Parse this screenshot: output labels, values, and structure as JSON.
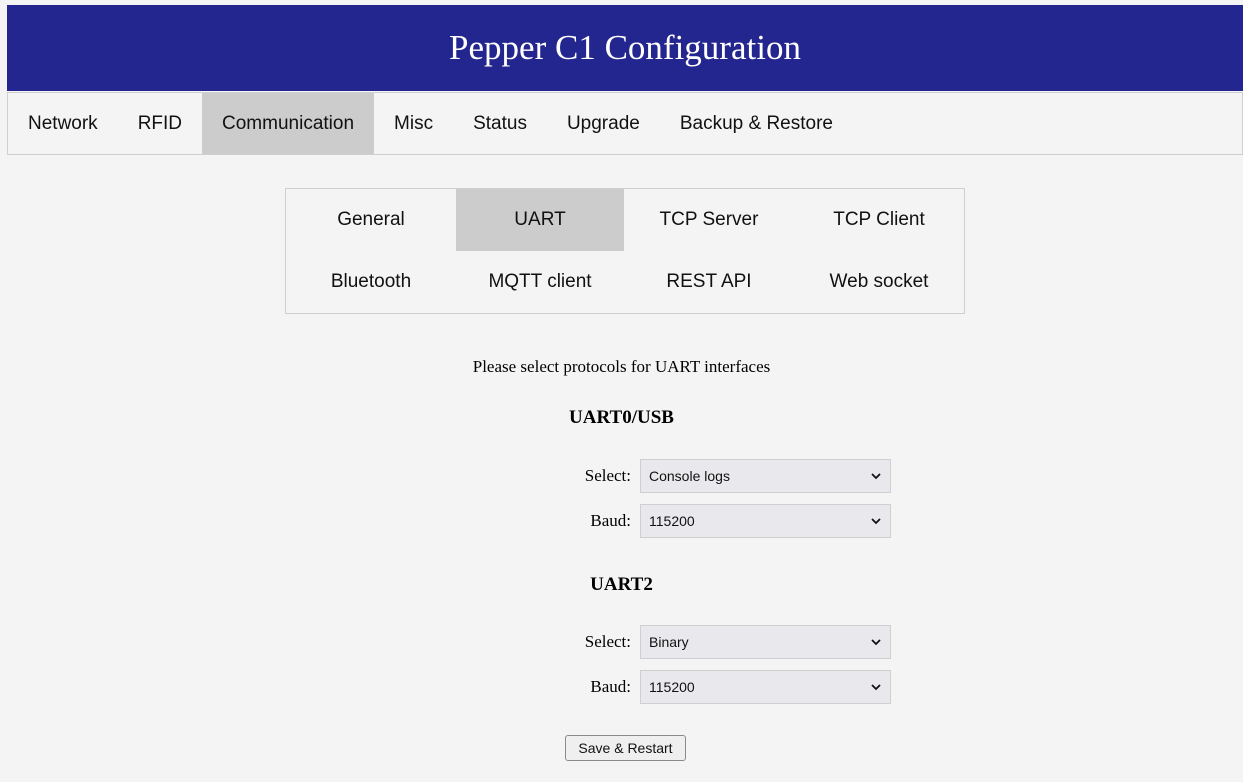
{
  "header": {
    "title": "Pepper C1 Configuration",
    "bg_color": "#24268f"
  },
  "topnav": {
    "items": [
      {
        "label": "Network"
      },
      {
        "label": "RFID"
      },
      {
        "label": "Communication",
        "active": true
      },
      {
        "label": "Misc"
      },
      {
        "label": "Status"
      },
      {
        "label": "Upgrade"
      },
      {
        "label": "Backup & Restore"
      }
    ]
  },
  "subnav": {
    "items": [
      {
        "label": "General"
      },
      {
        "label": "UART",
        "active": true
      },
      {
        "label": "TCP Server"
      },
      {
        "label": "TCP Client"
      },
      {
        "label": "Bluetooth"
      },
      {
        "label": "MQTT client"
      },
      {
        "label": "REST API"
      },
      {
        "label": "Web socket"
      }
    ]
  },
  "main": {
    "instruction": "Please select protocols for UART interfaces",
    "uart0": {
      "title": "UART0/USB",
      "select_label": "Select:",
      "select_value": "Console logs",
      "baud_label": "Baud:",
      "baud_value": "115200"
    },
    "uart2": {
      "title": "UART2",
      "select_label": "Select:",
      "select_value": "Binary",
      "baud_label": "Baud:",
      "baud_value": "115200"
    },
    "save_label": "Save & Restart"
  },
  "icons": {
    "dropdown": "chevron-down-icon"
  }
}
